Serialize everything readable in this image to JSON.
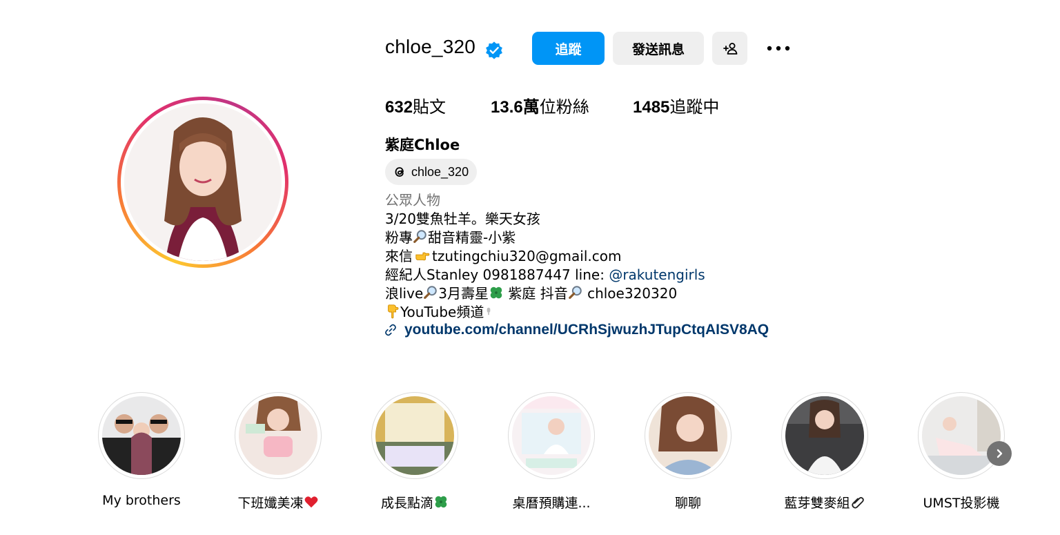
{
  "profile": {
    "username": "chloe_320",
    "full_name": "紫庭Chloe",
    "verified_icon": "verified-badge-icon",
    "follow_label": "追蹤",
    "message_label": "發送訊息",
    "suggest_icon": "person-add-icon",
    "more_icon": "more-dots-icon"
  },
  "stats": {
    "posts_count": "632",
    "posts_label": "貼文",
    "followers_count": "13.6萬",
    "followers_label": "位粉絲",
    "following_count": "1485",
    "following_label": "追蹤中"
  },
  "threads": {
    "handle": "chloe_320",
    "icon": "threads-icon"
  },
  "bio": {
    "category": "公眾人物",
    "line1": "3/20雙魚牡羊。樂天女孩",
    "line2_prefix": "粉專",
    "line2_suffix": "甜音精靈-小紫",
    "line3_prefix": "來信",
    "line3_suffix": "tzutingchiu320@gmail.com",
    "line4_prefix": "經紀人Stanley 0981887447 line: ",
    "line4_mention": "@rakutengirls",
    "line5_a": "浪live",
    "line5_b": "3月壽星",
    "line5_c": " 紫庭 抖音",
    "line5_d": " chloe320320",
    "line6": "YouTube頻道",
    "link": "youtube.com/channel/UCRhSjwuzhJTupCtqAISV8AQ"
  },
  "highlights": [
    {
      "label": "My brothers"
    },
    {
      "label": "下班孅美凍"
    },
    {
      "label": "成長點滴"
    },
    {
      "label": "桌曆預購連..."
    },
    {
      "label": "聊聊"
    },
    {
      "label": "藍芽雙麥組"
    },
    {
      "label": "UMST投影機"
    }
  ],
  "colors": {
    "accent": "#0095f6",
    "link": "#00376b",
    "muted": "#737373",
    "button_gray": "#efefef"
  }
}
